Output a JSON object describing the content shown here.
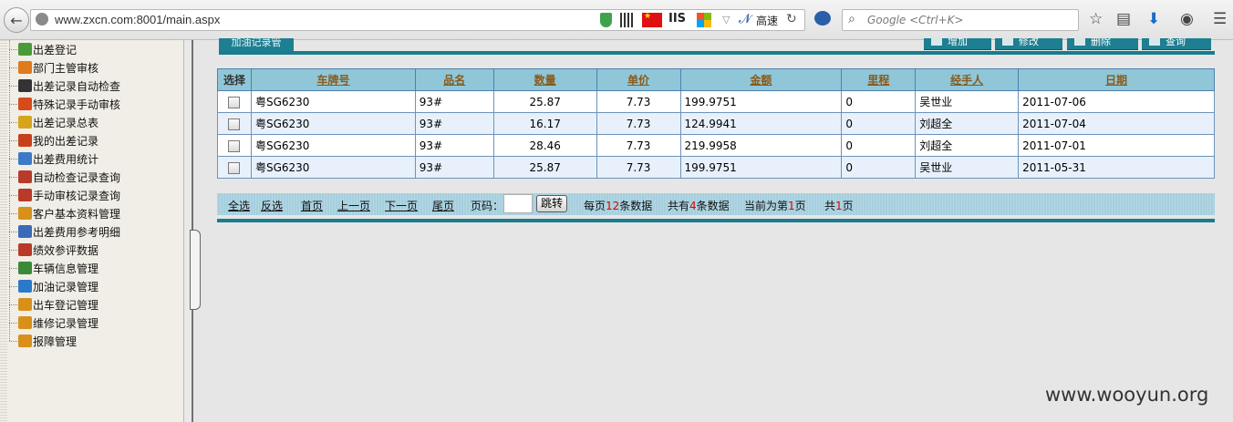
{
  "browser": {
    "url": "www.zxcn.com:8001/main.aspx",
    "iis_label": "IIS",
    "gaosu_label": "高速",
    "search_placeholder": "Google <Ctrl+K>"
  },
  "sidebar": {
    "items": [
      {
        "label": "出差登记",
        "color": "#4a9a3a"
      },
      {
        "label": "部门主管审核",
        "color": "#e07a1a"
      },
      {
        "label": "出差记录自动检查",
        "color": "#333333"
      },
      {
        "label": "特殊记录手动审核",
        "color": "#d84a1a"
      },
      {
        "label": "出差记录总表",
        "color": "#d8a41a"
      },
      {
        "label": "我的出差记录",
        "color": "#c8401a"
      },
      {
        "label": "出差费用统计",
        "color": "#3a7ac8"
      },
      {
        "label": "自动检查记录查询",
        "color": "#b83a2a"
      },
      {
        "label": "手动审核记录查询",
        "color": "#b83a2a"
      },
      {
        "label": "客户基本资料管理",
        "color": "#d8901a"
      },
      {
        "label": "出差费用参考明细",
        "color": "#3a6ab8"
      },
      {
        "label": "绩效参评数据",
        "color": "#b83a2a"
      },
      {
        "label": "车辆信息管理",
        "color": "#3a8a3a"
      },
      {
        "label": "加油记录管理",
        "color": "#2a7ac8"
      },
      {
        "label": "出车登记管理",
        "color": "#d8901a"
      },
      {
        "label": "维修记录管理",
        "color": "#d8901a"
      },
      {
        "label": "报障管理",
        "color": "#d8901a"
      }
    ]
  },
  "main": {
    "section_title": "加油记录管",
    "actions": [
      "增加",
      "修改",
      "删除",
      "查询"
    ],
    "columns": [
      "选择",
      "车牌号",
      "品名",
      "数量",
      "单价",
      "金额",
      "里程",
      "经手人",
      "日期"
    ],
    "rows": [
      {
        "plate": "粤SG6230",
        "product": "93#",
        "qty": "25.87",
        "price": "7.73",
        "amount": "199.9751",
        "mileage": "0",
        "handler": "吴世业",
        "date": "2011-07-06"
      },
      {
        "plate": "粤SG6230",
        "product": "93#",
        "qty": "16.17",
        "price": "7.73",
        "amount": "124.9941",
        "mileage": "0",
        "handler": "刘超全",
        "date": "2011-07-04"
      },
      {
        "plate": "粤SG6230",
        "product": "93#",
        "qty": "28.46",
        "price": "7.73",
        "amount": "219.9958",
        "mileage": "0",
        "handler": "刘超全",
        "date": "2011-07-01"
      },
      {
        "plate": "粤SG6230",
        "product": "93#",
        "qty": "25.87",
        "price": "7.73",
        "amount": "199.9751",
        "mileage": "0",
        "handler": "吴世业",
        "date": "2011-05-31"
      }
    ]
  },
  "pager": {
    "select_all": "全选",
    "invert": "反选",
    "first": "首页",
    "prev": "上一页",
    "next": "下一页",
    "last": "尾页",
    "page_label": "页码：",
    "jump": "跳转",
    "per_page_pre": "每页",
    "per_page_num": "12",
    "per_page_post": "条数据",
    "total_pre": "共有",
    "total_num": "4",
    "total_post": "条数据",
    "current_pre": "当前为第",
    "current_num": "1",
    "current_post": "页",
    "pages_pre": "共",
    "pages_num": "1",
    "pages_post": "页"
  },
  "watermark": "www.wooyun.org"
}
